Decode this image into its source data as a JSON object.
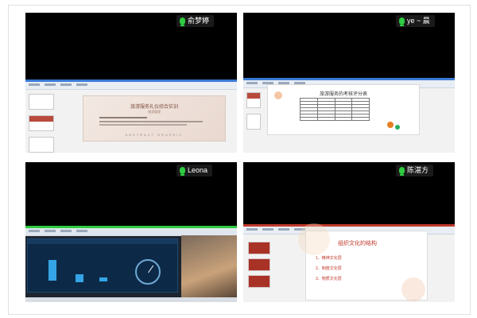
{
  "tiles": [
    {
      "participant_name": "俞梦婷",
      "slide_title": "旅游服务礼仪综合实训",
      "slide_subtitle": "旅游管理",
      "slide_footer": "ABSTRACT GRAPHIC"
    },
    {
      "participant_name": "ye ~ 晨",
      "doc_title": "旅游服务的考核评分表"
    },
    {
      "participant_name": "Leona"
    },
    {
      "participant_name": "陈湛方",
      "slide_title": "组织文化的结构",
      "items": [
        "1、精神文化层",
        "2、制度文化层",
        "3、物质文化层"
      ]
    }
  ],
  "colors": {
    "mic": "#2ecc40",
    "accent_red": "#c0392b",
    "tile_bg": "#000000"
  }
}
